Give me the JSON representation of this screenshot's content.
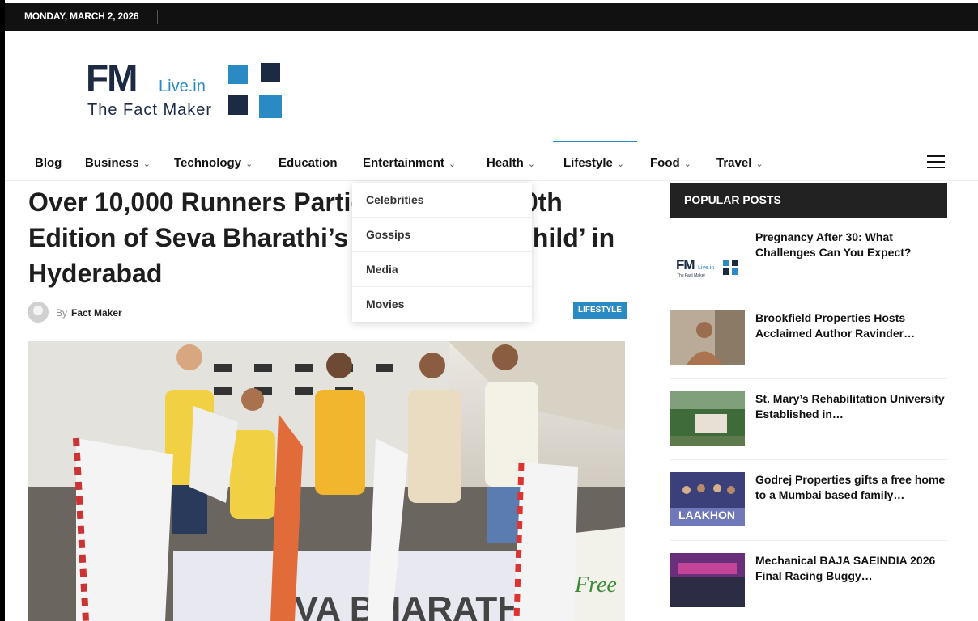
{
  "topbar": {
    "date": "MONDAY, MARCH 2, 2026"
  },
  "logo": {
    "fm": "FM",
    "livein": "Live.in",
    "tagline": "The Fact Maker"
  },
  "nav": {
    "items": [
      {
        "label": "Blog",
        "has_dropdown": false
      },
      {
        "label": "Business",
        "has_dropdown": true
      },
      {
        "label": "Technology",
        "has_dropdown": true
      },
      {
        "label": "Education",
        "has_dropdown": false
      },
      {
        "label": "Entertainment",
        "has_dropdown": true
      },
      {
        "label": "Health",
        "has_dropdown": true
      },
      {
        "label": "Lifestyle",
        "has_dropdown": true
      },
      {
        "label": "Food",
        "has_dropdown": true
      },
      {
        "label": "Travel",
        "has_dropdown": true
      }
    ],
    "chevron": "⌄",
    "active": "Lifestyle",
    "menu_icon": "hamburger-icon"
  },
  "dropdown": {
    "items": [
      "Celebrities",
      "Gossips",
      "Media",
      "Movies"
    ]
  },
  "article": {
    "title": "Over 10,000 Runners Participate in the 10th Edition of Seva Bharathi’s ‘Run for Girl Child’ in Hyderabad",
    "by": "By",
    "author": "Fact Maker",
    "category": "LIFESTYLE",
    "hero_text": "EVA BHARATHI"
  },
  "sidebar": {
    "title": "POPULAR POSTS",
    "posts": [
      {
        "title": "Pregnancy After 30: What Challenges Can You Expect?",
        "thumb": "fmlive-logo"
      },
      {
        "title": "Brookfield Properties Hosts Acclaimed Author Ravinder…",
        "thumb": "author-portrait"
      },
      {
        "title": "St. Mary’s Rehabilitation University Established in…",
        "thumb": "campus-photo"
      },
      {
        "title": "Godrej Properties gifts a free home to a Mumbai based family…",
        "thumb": "event-stage",
        "thumb_text": "LAAKHON"
      },
      {
        "title": "Mechanical BAJA SAEINDIA 2026 Final Racing Buggy…",
        "thumb": "group-photo"
      }
    ]
  },
  "colors": {
    "accent": "#2a8ac4",
    "navy": "#1d2a44",
    "topbar": "#111111"
  }
}
